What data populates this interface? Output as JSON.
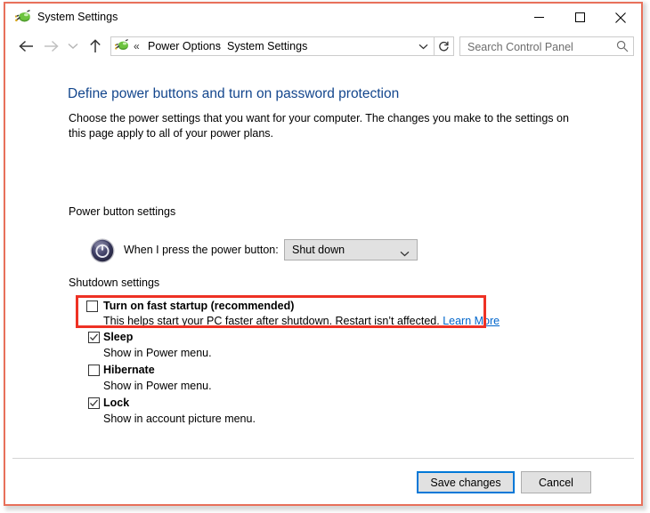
{
  "window": {
    "title": "System Settings",
    "icon": "power-options-icon",
    "caption": {
      "minimize": "minimize-icon",
      "maximize": "maximize-icon",
      "close": "close-icon"
    }
  },
  "navbar": {
    "back": "back-arrow-icon",
    "forward": "forward-arrow-icon",
    "history": "recent-locations-icon",
    "up": "up-arrow-icon",
    "address": {
      "icon": "power-options-icon",
      "overflow": "«",
      "separator": "›",
      "crumb1": "Power Options",
      "crumb2": "System Settings",
      "dropdown": "chevron-down-icon"
    },
    "refresh": "refresh-icon",
    "search": {
      "placeholder": "Search Control Panel",
      "value": "",
      "icon": "search-icon"
    }
  },
  "main": {
    "page_title": "Define power buttons and turn on password protection",
    "page_description": "Choose the power settings that you want for your computer. The changes you make to the settings on this page apply to all of your power plans.",
    "power_group": {
      "label": "Power button settings",
      "icon": "power-button-icon",
      "row_label": "When I press the power button:",
      "combo_value": "Shut down",
      "combo_arrow": "chevron-down-icon"
    },
    "shutdown_group": {
      "label": "Shutdown settings",
      "items": [
        {
          "name": "fast-startup",
          "label": "Turn on fast startup (recommended)",
          "checked": false,
          "description": "This helps start your PC faster after shutdown. Restart isn’t affected.",
          "link": "Learn More",
          "highlighted": true
        },
        {
          "name": "sleep",
          "label": "Sleep",
          "checked": true,
          "description": "Show in Power menu.",
          "link": "",
          "highlighted": false
        },
        {
          "name": "hibernate",
          "label": "Hibernate",
          "checked": false,
          "description": "Show in Power menu.",
          "link": "",
          "highlighted": false
        },
        {
          "name": "lock",
          "label": "Lock",
          "checked": true,
          "description": "Show in account picture menu.",
          "link": "",
          "highlighted": false
        }
      ]
    }
  },
  "footer": {
    "save_label": "Save changes",
    "cancel_label": "Cancel"
  },
  "colors": {
    "window_border": "#e8705a",
    "heading": "#13468d",
    "highlight": "#ee3124",
    "link": "#0066cc",
    "focus": "#0078d7"
  }
}
